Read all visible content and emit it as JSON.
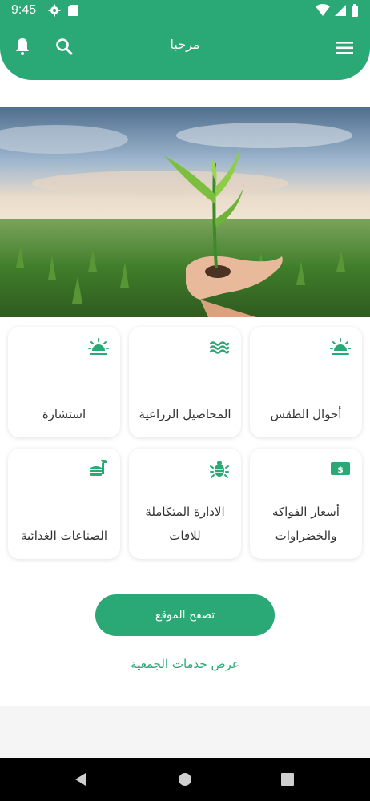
{
  "status_bar": {
    "time": "9:45",
    "icons": [
      "gear-icon",
      "sd-card-icon",
      "wifi-icon",
      "signal-icon",
      "battery-icon"
    ]
  },
  "app_bar": {
    "title": "مرحبا",
    "icons": [
      "bell-icon",
      "search-icon",
      "menu-icon"
    ]
  },
  "hero": {
    "image": "farmer-hand-seedling-field"
  },
  "cards": [
    {
      "label": "أحوال الطقس",
      "icon": "sun-weather-icon"
    },
    {
      "label": "المحاصيل الزراعية",
      "icon": "waves-icon"
    },
    {
      "label": "استشارة",
      "icon": "sun-weather-icon"
    },
    {
      "label": "أسعار الفواكه والخضراوات",
      "icon": "price-tag-icon"
    },
    {
      "label": "الادارة المتكاملة للافات",
      "icon": "bug-icon"
    },
    {
      "label": "الصناعات الغذائية",
      "icon": "food-icon"
    }
  ],
  "actions": {
    "browse_site": "تصفح الموقع",
    "view_services": "عرض خدمات الجمعية"
  },
  "colors": {
    "accent": "#2aa876"
  }
}
